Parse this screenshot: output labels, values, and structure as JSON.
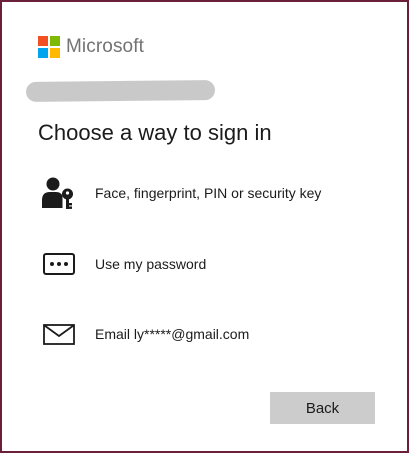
{
  "brand": {
    "name": "Microsoft",
    "logo_colors": [
      "#f25022",
      "#7fba00",
      "#00a4ef",
      "#ffb900"
    ]
  },
  "title": "Choose a way to sign in",
  "options": [
    {
      "icon": "user-key-icon",
      "label": "Face, fingerprint, PIN or security key"
    },
    {
      "icon": "password-icon",
      "label": "Use my password"
    },
    {
      "icon": "mail-icon",
      "label": "Email ly*****@gmail.com"
    }
  ],
  "buttons": {
    "back_label": "Back"
  },
  "colors": {
    "window_border": "#6b1f3a",
    "button_bg": "#cccccc",
    "text": "#1b1b1b",
    "brand_text": "#737373"
  }
}
